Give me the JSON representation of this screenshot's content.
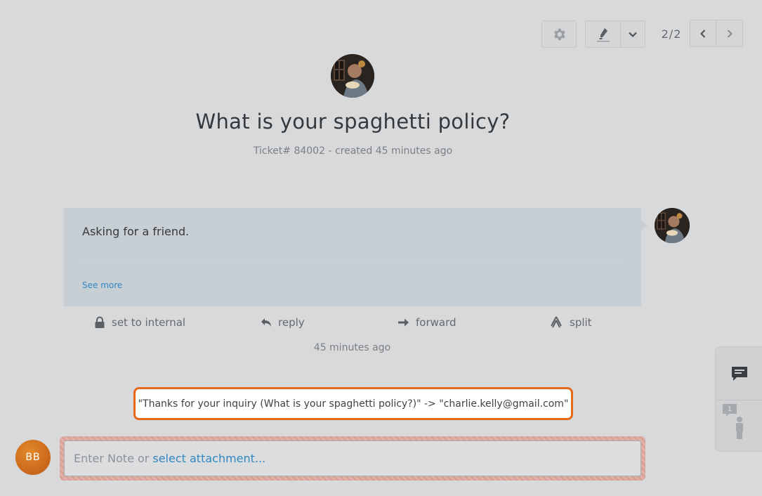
{
  "toolbar": {
    "settings_icon": "gear-icon",
    "highlighter_icon": "highlighter-icon",
    "dropdown_icon": "chevron-down-icon",
    "pager": "2/2",
    "prev_icon": "chevron-left-icon",
    "next_icon": "chevron-right-icon"
  },
  "ticket": {
    "title": "What is your spaghetti policy?",
    "meta": "Ticket# 84002 - created 45 minutes ago"
  },
  "article": {
    "body": "Asking for a friend.",
    "see_more": "See more",
    "timestamp": "45 minutes ago"
  },
  "actions": [
    {
      "label": "set to internal",
      "icon": "lock-icon"
    },
    {
      "label": "reply",
      "icon": "reply-icon"
    },
    {
      "label": "forward",
      "icon": "forward-icon"
    },
    {
      "label": "split",
      "icon": "split-icon"
    }
  ],
  "highlight": {
    "text": "\"Thanks for your inquiry (What is your spaghetti policy?)\" -> \"charlie.kelly@gmail.com\""
  },
  "composer": {
    "avatar_initials": "BB",
    "placeholder": "Enter Note or",
    "attachment_link": "select attachment..."
  },
  "sidebar": {
    "conversation_icon": "chat-icon",
    "customer_icon": "customer-icon",
    "customer_badge": "1"
  },
  "colors": {
    "background": "#d8d9db",
    "highlight_border": "#e6691a",
    "link": "#2f88c2",
    "avatar_bb": "#d06f1f"
  }
}
